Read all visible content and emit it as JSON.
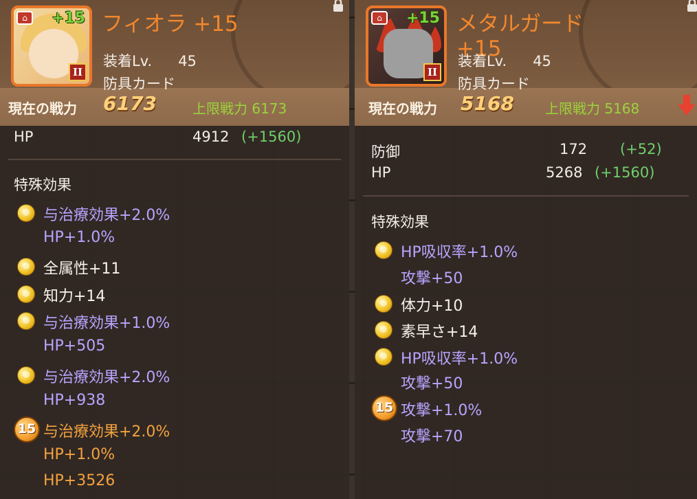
{
  "left": {
    "name": "フィオラ +15",
    "plus_badge": "+15",
    "grade": "II",
    "equip_label": "装着Lv.",
    "equip_level": "45",
    "kind": "防具カード",
    "current_power_label": "現在の戦力",
    "current_power": "6173",
    "max_power_label": "上限戦力",
    "max_power": "6173",
    "stats": [
      {
        "name": "HP",
        "value": "4912",
        "bonus": "(+1560)"
      }
    ],
    "effects_title": "特殊効果",
    "effects": [
      {
        "icon": "gold-coin-icon",
        "color": "purple",
        "lines": [
          "与治療効果+2.0%",
          "HP+1.0%"
        ]
      },
      {
        "icon": "gold-coin-icon",
        "color": "white",
        "lines": [
          "全属性+11"
        ]
      },
      {
        "icon": "gold-coin-icon",
        "color": "white",
        "lines": [
          "知力+14"
        ]
      },
      {
        "icon": "gold-coin-icon",
        "color": "purple",
        "lines": [
          "与治療効果+1.0%",
          "HP+505"
        ]
      },
      {
        "icon": "gold-coin-icon",
        "color": "purple",
        "lines": [
          "与治療効果+2.0%",
          "HP+938"
        ]
      },
      {
        "icon": "level-15-badge-icon",
        "badge": "15",
        "color": "orange",
        "lines": [
          "与治療効果+2.0%",
          "HP+1.0%",
          "HP+3526"
        ]
      }
    ]
  },
  "right": {
    "name_line1": "メタルガード",
    "name_line2": "+15",
    "plus_badge": "+15",
    "grade": "II",
    "equip_label": "装着Lv.",
    "equip_level": "45",
    "kind": "防具カード",
    "current_power_label": "現在の戦力",
    "current_power": "5168",
    "max_power_label": "上限戦力",
    "max_power": "5168",
    "stats": [
      {
        "name": "防御",
        "value": "172",
        "bonus": "(+52)"
      },
      {
        "name": "HP",
        "value": "5268",
        "bonus": "(+1560)"
      }
    ],
    "effects_title": "特殊効果",
    "effects": [
      {
        "icon": "gold-coin-icon",
        "color": "purple",
        "lines": [
          "HP吸収率+1.0%",
          "攻撃+50"
        ]
      },
      {
        "icon": "gold-coin-icon",
        "color": "white",
        "lines": [
          "体力+10"
        ]
      },
      {
        "icon": "gold-coin-icon",
        "color": "white",
        "lines": [
          "素早さ+14"
        ]
      },
      {
        "icon": "gold-coin-icon",
        "color": "purple",
        "lines": [
          "HP吸収率+1.0%",
          "攻撃+50"
        ]
      },
      {
        "icon": "level-15-badge-icon",
        "badge": "15",
        "color": "purple",
        "lines": [
          "攻撃+1.0%",
          "攻撃+70"
        ]
      }
    ]
  },
  "colors": {
    "name_orange": "#f2872d",
    "max_power_green": "#9ad43c",
    "bonus_green": "#6fd16a",
    "effect_purple": "#b7a5ff",
    "effect_orange": "#f3a23e",
    "compare_down_red": "#e8412f"
  }
}
